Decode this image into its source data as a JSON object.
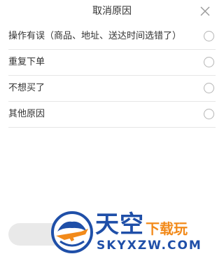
{
  "dialog": {
    "title": "取消原因",
    "close_icon": "close-icon"
  },
  "reasons": [
    {
      "label": "操作有误（商品、地址、送达时间选错了）"
    },
    {
      "label": "重复下单"
    },
    {
      "label": "不想买了"
    },
    {
      "label": "其他原因"
    }
  ],
  "watermark": {
    "brand_main": "天空",
    "brand_sub": "下载玩",
    "domain": "SKYXZW.COM"
  },
  "colors": {
    "watermark_blue": "#1f4fa8",
    "watermark_orange": "#f28a1a"
  }
}
